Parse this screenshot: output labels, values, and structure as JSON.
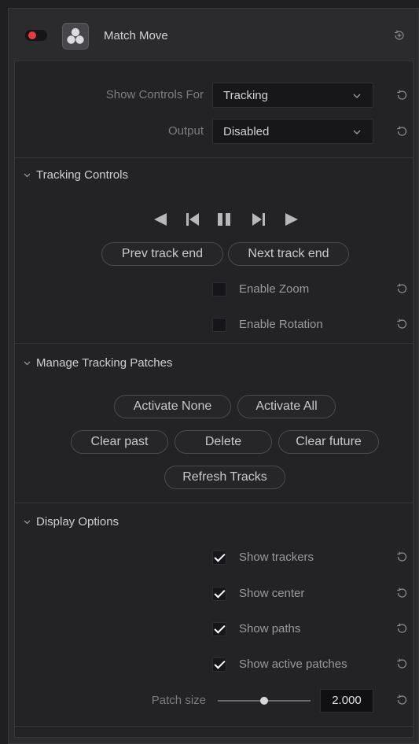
{
  "header": {
    "title": "Match Move",
    "enabled": true,
    "toggle_color": "#e53d3d",
    "plugin_icon": "davinci-resolve-icon",
    "reset_icon": "reset-all-icon"
  },
  "main": {
    "show_controls_for": {
      "label": "Show Controls For",
      "value": "Tracking"
    },
    "output": {
      "label": "Output",
      "value": "Disabled"
    }
  },
  "tracking_controls": {
    "title": "Tracking Controls",
    "transport": [
      "track-reverse-icon",
      "step-back-icon",
      "pause-icon",
      "step-forward-icon",
      "track-forward-icon"
    ],
    "prev_track_end": "Prev track end",
    "next_track_end": "Next track end",
    "enable_zoom": {
      "label": "Enable Zoom",
      "checked": false
    },
    "enable_rotation": {
      "label": "Enable Rotation",
      "checked": false
    }
  },
  "manage_patches": {
    "title": "Manage Tracking Patches",
    "activate_none": "Activate None",
    "activate_all": "Activate All",
    "clear_past": "Clear past",
    "delete": "Delete",
    "clear_future": "Clear future",
    "refresh_tracks": "Refresh Tracks"
  },
  "display_options": {
    "title": "Display Options",
    "show_trackers": {
      "label": "Show trackers",
      "checked": true
    },
    "show_center": {
      "label": "Show center",
      "checked": true
    },
    "show_paths": {
      "label": "Show paths",
      "checked": true
    },
    "show_active_patches": {
      "label": "Show active patches",
      "checked": true
    },
    "patch_size": {
      "label": "Patch size",
      "value": "2.000",
      "slider_fraction": 0.5
    }
  }
}
